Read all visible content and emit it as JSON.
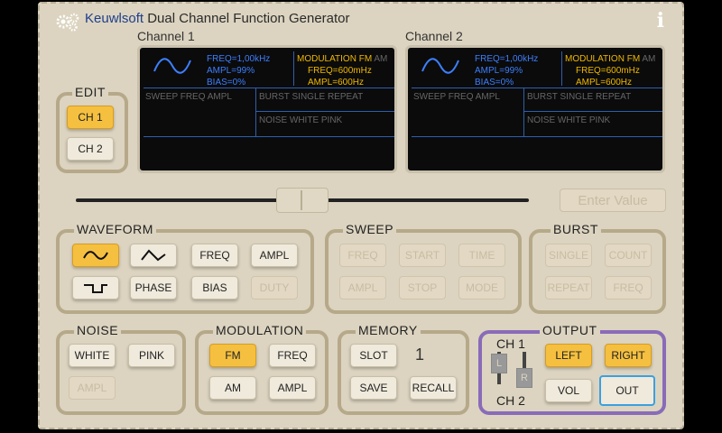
{
  "app": {
    "company": "Keuwlsoft",
    "title": "Dual Channel Function Generator",
    "info_icon": "i"
  },
  "channels": [
    {
      "label": "Channel 1",
      "freq": "FREQ=1,00kHz",
      "ampl": "AMPL=99%",
      "bias": "BIAS=0%",
      "mod_title": "MODULATION FM",
      "mod_am": "AM",
      "mod_freq": "FREQ=600mHz",
      "mod_ampl": "AMPL=600Hz",
      "sweep": "SWEEP  FREQ  AMPL",
      "burst": "BURST  SINGLE  REPEAT",
      "noise": "NOISE  WHITE  PINK"
    },
    {
      "label": "Channel 2",
      "freq": "FREQ=1,00kHz",
      "ampl": "AMPL=99%",
      "bias": "BIAS=0%",
      "mod_title": "MODULATION FM",
      "mod_am": "AM",
      "mod_freq": "FREQ=600mHz",
      "mod_ampl": "AMPL=600Hz",
      "sweep": "SWEEP  FREQ  AMPL",
      "burst": "BURST  SINGLE  REPEAT",
      "noise": "NOISE  WHITE  PINK"
    }
  ],
  "edit": {
    "label": "EDIT",
    "ch1": "CH 1",
    "ch2": "CH 2"
  },
  "enter_value": "Enter Value",
  "waveform": {
    "label": "WAVEFORM",
    "freq": "FREQ",
    "ampl": "AMPL",
    "phase": "PHASE",
    "bias": "BIAS",
    "duty": "DUTY"
  },
  "sweep": {
    "label": "SWEEP",
    "freq": "FREQ",
    "start": "START",
    "time": "TIME",
    "ampl": "AMPL",
    "stop": "STOP",
    "mode": "MODE"
  },
  "burst": {
    "label": "BURST",
    "single": "SINGLE",
    "count": "COUNT",
    "repeat": "REPEAT",
    "freq": "FREQ"
  },
  "noise": {
    "label": "NOISE",
    "white": "WHITE",
    "pink": "PINK",
    "ampl": "AMPL"
  },
  "modulation": {
    "label": "MODULATION",
    "fm": "FM",
    "freq": "FREQ",
    "am": "AM",
    "ampl": "AMPL"
  },
  "memory": {
    "label": "MEMORY",
    "slot": "SLOT",
    "slot_value": "1",
    "save": "SAVE",
    "recall": "RECALL"
  },
  "output": {
    "label": "OUTPUT",
    "ch1": "CH 1",
    "ch2": "CH 2",
    "left": "LEFT",
    "right": "RIGHT",
    "vol": "VOL",
    "out": "OUT",
    "toggle_l": "L",
    "toggle_r": "R"
  },
  "colors": {
    "accent": "#f5c040",
    "output_border": "#8a6bb8",
    "screen_blue": "#3d7fff",
    "screen_gold": "#f0b800"
  }
}
